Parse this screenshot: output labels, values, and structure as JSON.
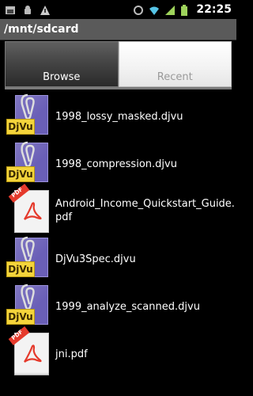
{
  "statusbar": {
    "time": "22:25",
    "left_icons": [
      "photo-icon",
      "android-icon",
      "warning-icon"
    ],
    "right_icons": [
      "sync-icon",
      "wifi-icon",
      "signal-icon",
      "battery-icon"
    ]
  },
  "path": "/mnt/sdcard",
  "tabs": [
    {
      "label": "Browse",
      "selected": true
    },
    {
      "label": "Recent",
      "selected": false
    }
  ],
  "files": [
    {
      "name": "1998_lossy_masked.djvu",
      "icon": "djvu-file-icon"
    },
    {
      "name": "1998_compression.djvu",
      "icon": "djvu-file-icon"
    },
    {
      "name_line1": "Android_Income_Quickstart_Guide.",
      "name_line2": "pdf",
      "icon": "pdf-file-icon"
    },
    {
      "name": "DjVu3Spec.djvu",
      "icon": "djvu-file-icon"
    },
    {
      "name": "1999_analyze_scanned.djvu",
      "icon": "djvu-file-icon"
    },
    {
      "name": "jni.pdf",
      "icon": "pdf-file-icon"
    }
  ],
  "djvu_badge": "DjVu",
  "pdf_corner": "PDF",
  "colors": {
    "djvu_purple": "#6a5fb7",
    "djvu_yellow": "#f4d43b",
    "pdf_red": "#e53a2c"
  }
}
